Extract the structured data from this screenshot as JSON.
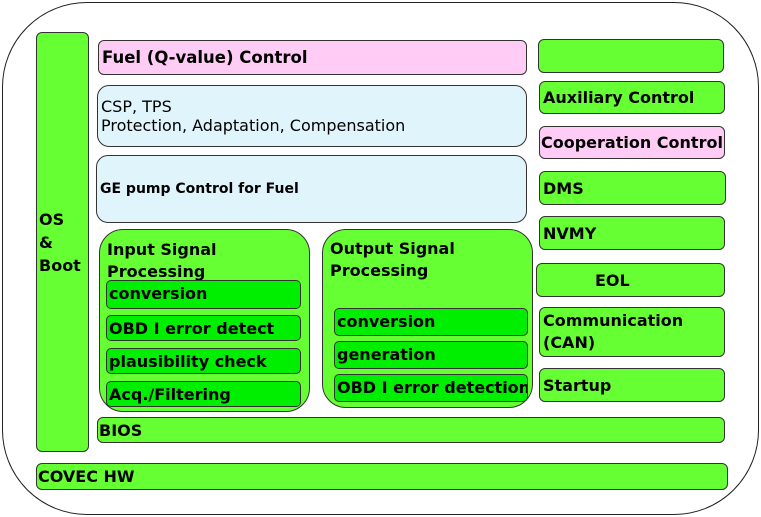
{
  "diagram": {
    "os_boot": {
      "lines": [
        "OS",
        "&",
        "Boot"
      ]
    },
    "fuel_control": "Fuel (Q-value) Control",
    "csp_tps": {
      "line1": "CSP, TPS",
      "line2": "Protection, Adaptation, Compensation"
    },
    "ge_pump": "GE pump Control for Fuel",
    "input_processing": {
      "title": "Input Signal\nProcessing",
      "items": [
        "conversion",
        "OBD I error detect",
        "plausibility check",
        "Acq./Filtering"
      ]
    },
    "output_processing": {
      "title": "Output Signal\nProcessing",
      "items": [
        "conversion",
        "generation",
        "OBD I error detection"
      ]
    },
    "right_column": {
      "blank": "",
      "auxiliary": "Auxiliary Control",
      "cooperation": "Cooperation Control",
      "dms": "DMS",
      "nvmy": "NVMY",
      "eol": "EOL",
      "communication": {
        "line1": "Communication",
        "line2": "(CAN)"
      },
      "startup": "Startup"
    },
    "bios": "BIOS",
    "hw": "COVEC HW"
  },
  "colors": {
    "module_green": "#66ff33",
    "sub_green": "#00ee00",
    "pink": "#ffccf5",
    "light_blue": "#e0f4fb"
  }
}
